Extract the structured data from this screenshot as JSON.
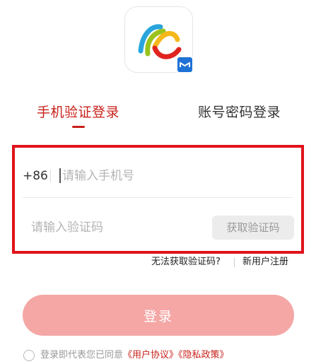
{
  "app": {
    "logo_icon": "app-logo",
    "badge_icon": "mail-badge-icon"
  },
  "tabs": {
    "sms_login": "手机验证登录",
    "password_login": "账号密码登录",
    "active": "sms_login"
  },
  "form": {
    "country_code": "+86",
    "phone_placeholder": "请输入手机号",
    "phone_value": "",
    "code_placeholder": "请输入验证码",
    "code_value": "",
    "get_code_label": "获取验证码"
  },
  "help": {
    "cant_get_code": "无法获取验证码?",
    "register": "新用户注册"
  },
  "login_label": "登录",
  "agreement": {
    "prefix": "登录即代表您已同意",
    "user_agreement": "《用户协议》",
    "privacy_policy": "《隐私政策》",
    "checked": false
  },
  "colors": {
    "accent": "#c8211b",
    "highlight_frame": "#e0131b",
    "login_button": "#f4a7a5",
    "badge": "#1e72d6"
  }
}
